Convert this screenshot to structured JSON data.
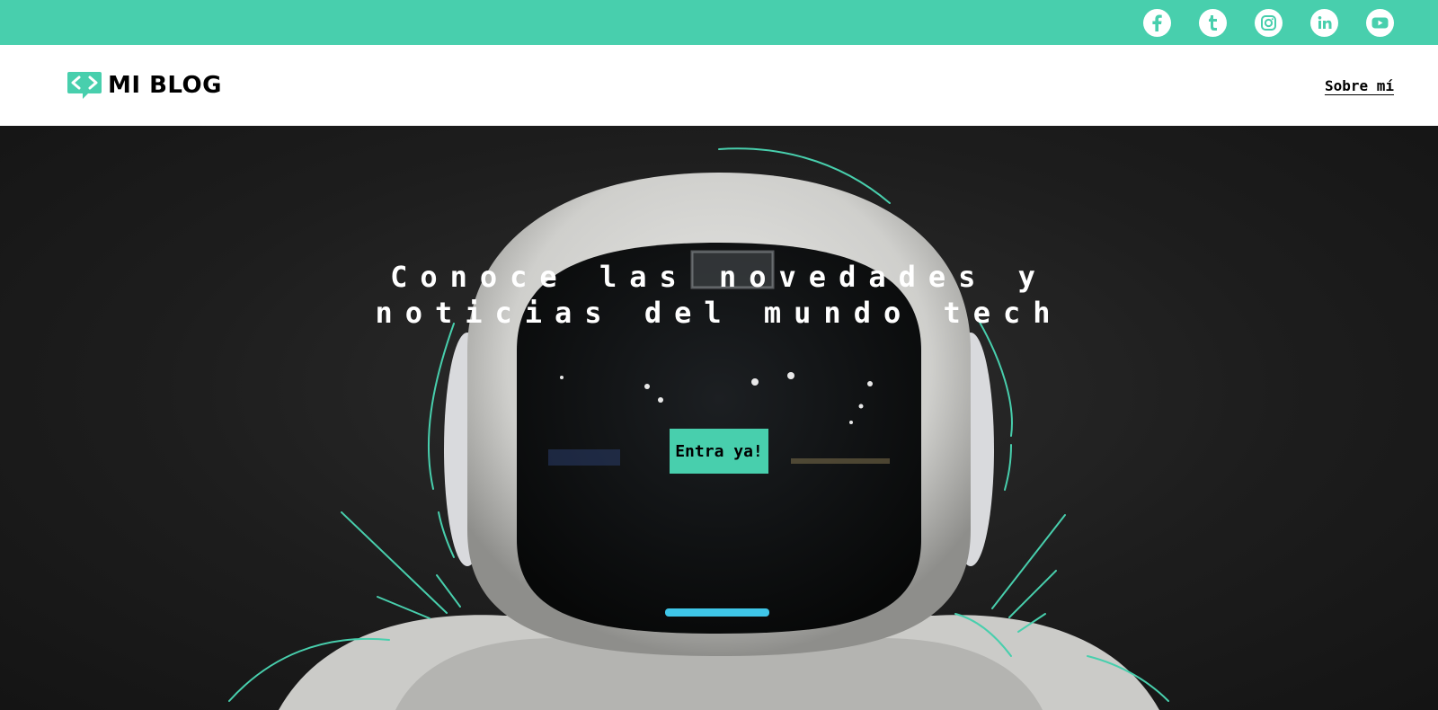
{
  "topbar": {
    "color": "#48cfad",
    "social_links": [
      {
        "name": "facebook",
        "icon": "facebook-icon"
      },
      {
        "name": "tumblr",
        "icon": "tumblr-icon"
      },
      {
        "name": "instagram",
        "icon": "instagram-icon"
      },
      {
        "name": "linkedin",
        "icon": "linkedin-icon"
      },
      {
        "name": "youtube",
        "icon": "youtube-icon"
      }
    ]
  },
  "header": {
    "logo_text": "MI BLOG",
    "logo_icon": "code-bubble-icon",
    "nav": {
      "about_label": "Sobre mí"
    }
  },
  "hero": {
    "title": "Conoce las novedades y noticias del mundo tech",
    "cta_label": "Entra ya!",
    "background_image": "robot-astronaut-helmet",
    "accent": "#48cfad"
  }
}
